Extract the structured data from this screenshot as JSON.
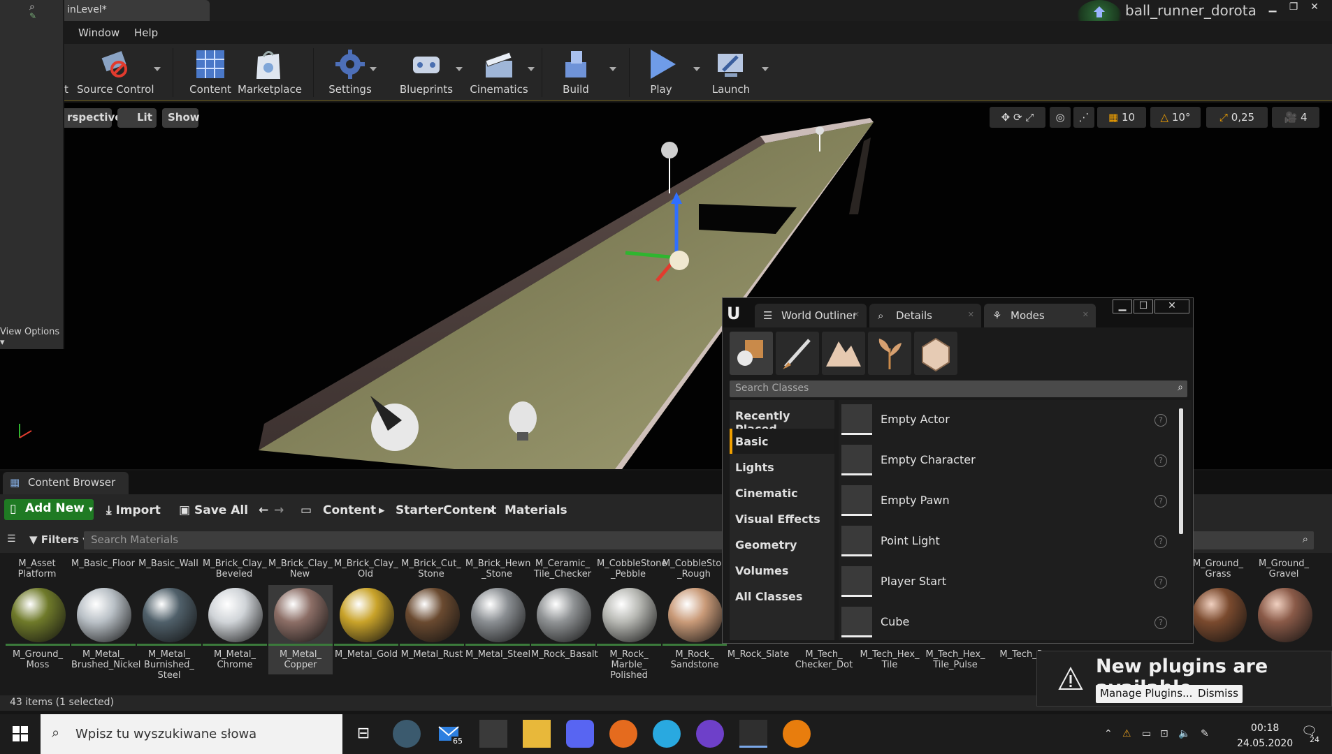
{
  "window": {
    "tab_title": "inLevel*",
    "project_name": "ball_runner_dorota",
    "min": "▁",
    "max": "❐",
    "close": "✕"
  },
  "menu": {
    "items": [
      "Window",
      "Help"
    ]
  },
  "toolbar": {
    "buttons": [
      {
        "label": "Source Control",
        "pre": "t"
      },
      {
        "label": "Content"
      },
      {
        "label": "Marketplace"
      },
      {
        "label": "Settings"
      },
      {
        "label": "Blueprints"
      },
      {
        "label": "Cinematics"
      },
      {
        "label": "Build"
      },
      {
        "label": "Play"
      },
      {
        "label": "Launch"
      }
    ]
  },
  "left_panel": {
    "view_options": "View Options"
  },
  "viewport": {
    "perspective": "rspective",
    "lit": "Lit",
    "show": "Show",
    "grid_snap": "10",
    "rot_snap": "10°",
    "scale_snap": "0,25",
    "cam_speed": "4"
  },
  "modes_window": {
    "tabs": [
      "World Outliner",
      "Details",
      "Modes"
    ],
    "search_placeholder": "Search Classes",
    "categories": [
      "Recently Placed",
      "Basic",
      "Lights",
      "Cinematic",
      "Visual Effects",
      "Geometry",
      "Volumes",
      "All Classes"
    ],
    "active_category": "Basic",
    "classes": [
      "Empty Actor",
      "Empty Character",
      "Empty Pawn",
      "Point Light",
      "Player Start",
      "Cube"
    ],
    "help": "?"
  },
  "content_browser": {
    "tab": "Content Browser",
    "add_new": "Add New",
    "import": "Import",
    "save_all": "Save All",
    "breadcrumb": [
      "Content",
      "StarterContent",
      "Materials"
    ],
    "filters": "Filters",
    "search_placeholder": "Search Materials",
    "top_row": [
      "M_Asset Platform",
      "M_Basic_Floor",
      "M_Basic_Wall",
      "M_Brick_Clay_ Beveled",
      "M_Brick_Clay_ New",
      "M_Brick_Clay_ Old",
      "M_Brick_Cut_ Stone",
      "M_Brick_Hewn _Stone",
      "M_Ceramic_ Tile_Checker",
      "M_CobbleStone _Pebble",
      "M_CobbleStone _Rough",
      "M_Ground_ Grass",
      "M_Ground_ Gravel"
    ],
    "assets": [
      {
        "name": "M_Ground_ Moss",
        "color": "#6f7a2a"
      },
      {
        "name": "M_Metal_ Brushed_Nickel",
        "color": "#b9c0c6"
      },
      {
        "name": "M_Metal_ Burnished_ Steel",
        "color": "#50606a"
      },
      {
        "name": "M_Metal_ Chrome",
        "color": "#d0d4d8"
      },
      {
        "name": "M_Metal_ Copper",
        "color": "#8c6e66"
      },
      {
        "name": "M_Metal_Gold",
        "color": "#c9a32a"
      },
      {
        "name": "M_Metal_Rust",
        "color": "#6a4a30"
      },
      {
        "name": "M_Metal_Steel",
        "color": "#8a8e92"
      },
      {
        "name": "M_Rock_Basalt",
        "color": "#8f9294"
      },
      {
        "name": "M_Rock_ Marble_ Polished",
        "color": "#b7b8b3"
      },
      {
        "name": "M_Rock_ Sandstone",
        "color": "#c99a78"
      }
    ],
    "bottom_right_names": [
      "M_Rock_Slate",
      "M_Tech_ Checker_Dot",
      "M_Tech_Hex_ Tile",
      "M_Tech_Hex_ Tile_Pulse",
      "M_Tech_P"
    ],
    "right_spheres": [
      {
        "color": "#7a4a2e"
      },
      {
        "color": "#8a5a48"
      }
    ],
    "status": "43 items (1 selected)"
  },
  "notification": {
    "title": "New plugins are available",
    "manage": "Manage Plugins...",
    "dismiss": "Dismiss"
  },
  "taskbar": {
    "search_text": "Wpisz tu wyszukiwane słowa",
    "mail_badge": "65",
    "time": "00:18",
    "date": "24.05.2020",
    "notif_count": "24"
  }
}
